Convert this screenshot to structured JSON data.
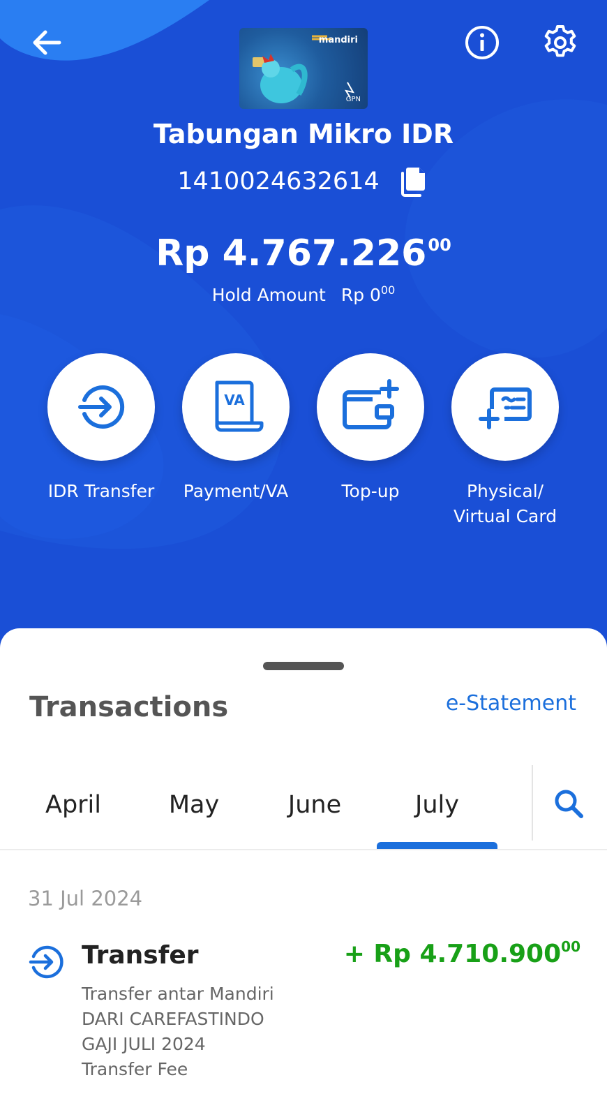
{
  "header": {
    "back_icon": "arrow-left-icon",
    "info_icon": "info-icon",
    "settings_icon": "gear-icon",
    "card_brand": "mandiri",
    "card_network": "GPN"
  },
  "account": {
    "name": "Tabungan Mikro IDR",
    "number": "1410024632614",
    "copy_icon": "copy-icon",
    "balance_main": "Rp 4.767.226",
    "balance_cents": "00",
    "hold_label": "Hold Amount",
    "hold_main": "Rp 0",
    "hold_cents": "00"
  },
  "actions": [
    {
      "label": "IDR Transfer",
      "icon": "transfer-icon"
    },
    {
      "label": "Payment/VA",
      "icon": "va-bill-icon"
    },
    {
      "label": "Top-up",
      "icon": "wallet-topup-icon"
    },
    {
      "label": "Physical/\nVirtual Card",
      "icon": "card-add-icon"
    }
  ],
  "transactions": {
    "title": "Transactions",
    "estatement_label": "e-Statement",
    "tabs": [
      "April",
      "May",
      "June",
      "July"
    ],
    "active_tab": "July",
    "search_icon": "search-icon",
    "groups": [
      {
        "date": "31 Jul 2024",
        "items": [
          {
            "title": "Transfer",
            "amount_main": "+ Rp 4.710.900",
            "amount_cents": "00",
            "description": [
              "Transfer antar Mandiri",
              "DARI CAREFASTINDO",
              "GAJI JULI 2024",
              "Transfer Fee"
            ],
            "icon": "transfer-icon"
          }
        ]
      }
    ]
  },
  "colors": {
    "primary_bg": "#1a4fd6",
    "accent": "#1b6fdc",
    "credit": "#18a017"
  }
}
